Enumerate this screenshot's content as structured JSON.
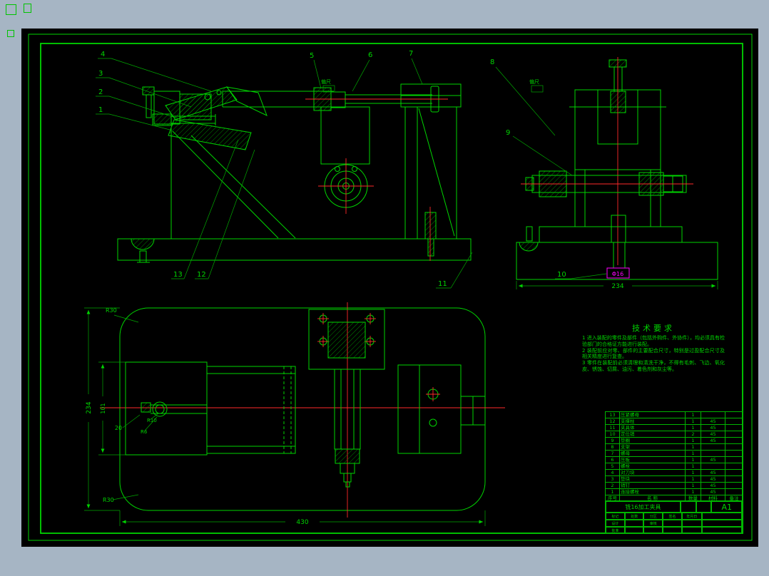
{
  "colors": {
    "background": "#a6b5c4",
    "sheet": "#000000",
    "line_green": "#00d400",
    "centerline_red": "#ff2a2a",
    "highlight_magenta": "#ff00ff"
  },
  "balloons": {
    "n1": "1",
    "n2": "2",
    "n3": "3",
    "n4": "4",
    "n5": "5",
    "n6": "6",
    "n7": "7",
    "n8": "8",
    "n9": "9",
    "n10": "10",
    "n11": "11",
    "n12": "12",
    "n13": "13"
  },
  "marks": {
    "front": "偏尺",
    "side": "偏尺"
  },
  "dims": {
    "side_width": "234",
    "plan_width": "430",
    "plan_depth": "234",
    "plan_inner": "101",
    "plan_offset": "20",
    "r10": "R10",
    "r6": "R6",
    "r30_top": "R30",
    "r30_bottom": "R30",
    "bore": "Φ16"
  },
  "tech_req": {
    "title": "技术要求",
    "lines": [
      "1 进入装配的零件及部件（包括外购件、外协件），均必须具有检验部门的合格证方能进行装配。",
      "2 装配前应对零、部件的主要配合尺寸，特别是过盈配合尺寸及相关精度进行复查。",
      "3 零件在装配前必须清理和清洗干净，不得有毛刺、飞边、氧化皮、锈蚀、切屑、油污、着色剂和灰尘等。"
    ]
  },
  "bom": {
    "headers": [
      "序号",
      "名  称",
      "数量",
      "材料",
      "备注"
    ],
    "rows": [
      {
        "no": "13",
        "name": "压紧螺母",
        "qty": "1",
        "mat": ""
      },
      {
        "no": "12",
        "name": "支撑柱",
        "qty": "1",
        "mat": "45"
      },
      {
        "no": "11",
        "name": "夹具体",
        "qty": "1",
        "mat": "45"
      },
      {
        "no": "10",
        "name": "定位销",
        "qty": "2",
        "mat": "45"
      },
      {
        "no": "9",
        "name": "垫圈",
        "qty": "1",
        "mat": "45"
      },
      {
        "no": "8",
        "name": "支架",
        "qty": "1",
        "mat": ""
      },
      {
        "no": "7",
        "name": "螺母",
        "qty": "1",
        "mat": ""
      },
      {
        "no": "6",
        "name": "压板",
        "qty": "1",
        "mat": "45"
      },
      {
        "no": "5",
        "name": "螺栓",
        "qty": "1",
        "mat": ""
      },
      {
        "no": "4",
        "name": "对刀块",
        "qty": "1",
        "mat": "45"
      },
      {
        "no": "3",
        "name": "垫块",
        "qty": "1",
        "mat": "45"
      },
      {
        "no": "2",
        "name": "销钉",
        "qty": "1",
        "mat": "45"
      },
      {
        "no": "1",
        "name": "连接螺栓",
        "qty": "1",
        "mat": "45"
      }
    ]
  },
  "title_block": {
    "title": "铣16加工夹具",
    "size": "A1",
    "labels": [
      "标记",
      "处数",
      "分区",
      "签名",
      "年月日",
      "设计",
      "审核",
      "批准"
    ]
  }
}
